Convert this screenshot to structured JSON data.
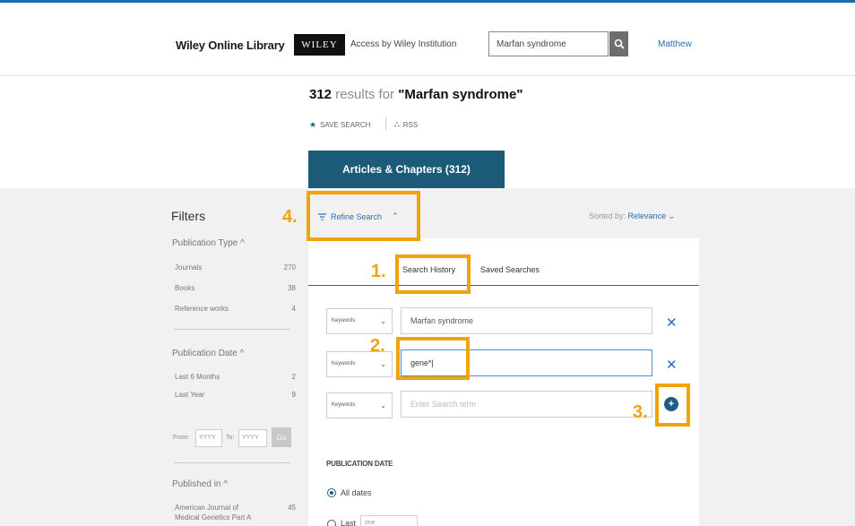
{
  "header": {
    "brand": "Wiley Online Library",
    "logo_text": "WILEY",
    "access_text": "Access by Wiley Institution",
    "search_value": "Marfan syndrome",
    "user": "Matthew"
  },
  "results": {
    "count": "312",
    "mid": " results for ",
    "term": "\"Marfan syndrome\"",
    "save_search": "SAVE SEARCH",
    "rss": "RSS",
    "tab_label": "Articles & Chapters (312)"
  },
  "filters": {
    "title": "Filters",
    "publication_type": {
      "title": "Publication Type ^",
      "rows": [
        {
          "label": "Journals",
          "count": "270"
        },
        {
          "label": "Books",
          "count": "38"
        },
        {
          "label": "Reference works",
          "count": "4"
        }
      ]
    },
    "publication_date": {
      "title": "Publication Date ^",
      "rows": [
        {
          "label": "Last 6 Months",
          "count": "2"
        },
        {
          "label": "Last Year",
          "count": "9"
        }
      ],
      "from_label": "From:",
      "to_label": "To:",
      "from_placeholder": "YYYY",
      "to_placeholder": "YYYY",
      "go_label": "Go"
    },
    "published_in": {
      "title": "Published in ^",
      "rows": [
        {
          "label": "American Journal of",
          "count": "45"
        },
        {
          "label": "Medical Genetics Part A",
          "count": ""
        }
      ]
    }
  },
  "refine": {
    "label": "Refine Search",
    "sorted_label": "Sorted by:",
    "sorted_value": "Relevance"
  },
  "panel": {
    "tab_history": "Search History",
    "tab_saved": "Saved Searches",
    "rows": [
      {
        "field": "Keywords",
        "value": "Marfan syndrome"
      },
      {
        "field": "Keywords",
        "value": "gene*|"
      },
      {
        "field": "Keywords",
        "placeholder": "Enter Search term"
      }
    ],
    "pub_date_title": "PUBLICATION DATE",
    "all_dates": "All dates",
    "last_label": "Last",
    "last_value": "one"
  },
  "annotations": {
    "n1": "1.",
    "n2": "2.",
    "n3": "3.",
    "n4": "4."
  },
  "colors": {
    "accent": "#1c5b78",
    "highlight": "#f0a30a",
    "link": "#2b6cb0"
  }
}
